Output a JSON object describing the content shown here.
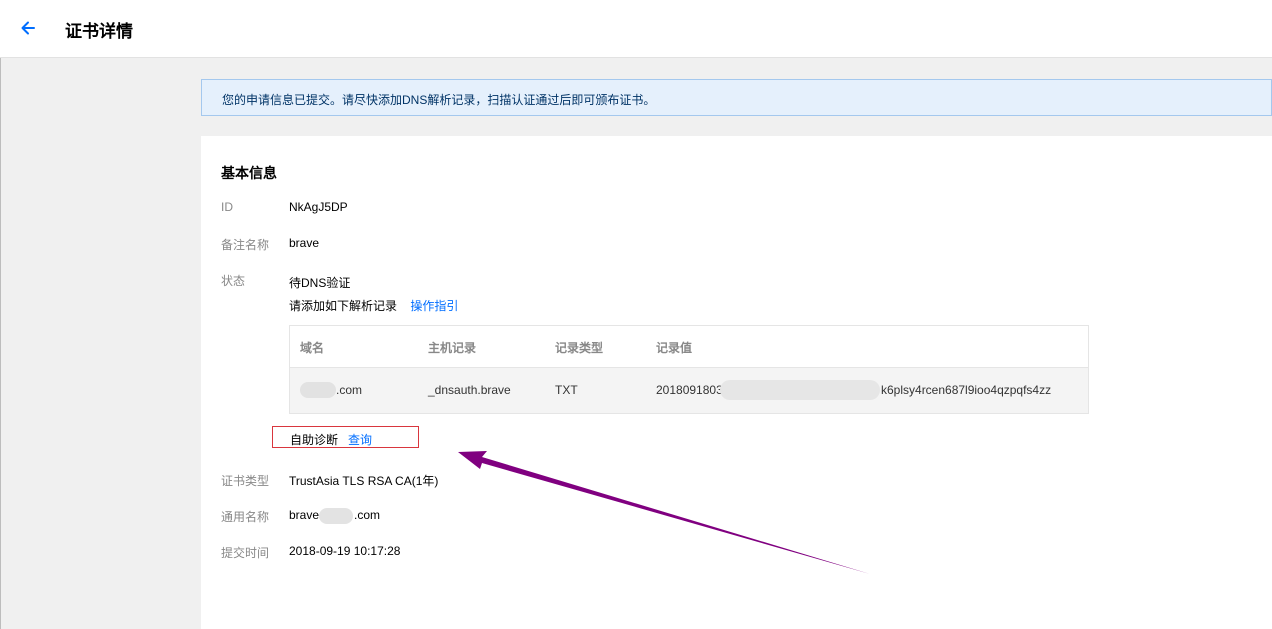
{
  "header": {
    "title": "证书详情",
    "back_icon": "arrow-left-icon"
  },
  "notice": {
    "text": "您的申请信息已提交。请尽快添加DNS解析记录，扫描认证通过后即可颁布证书。"
  },
  "basic_info": {
    "section_title": "基本信息",
    "id_label": "ID",
    "id_value": "NkAgJ5DP",
    "remark_label": "备注名称",
    "remark_value": "brave",
    "status_label": "状态",
    "status_value": "待DNS验证",
    "dns_prompt": "请添加如下解析记录",
    "guide_link": "操作指引",
    "dns_table": {
      "headers": [
        "域名",
        "主机记录",
        "记录类型",
        "记录值"
      ],
      "row": {
        "domain": ".com",
        "host": "_dnsauth.brave",
        "type": "TXT",
        "value_prefix": "2018091803",
        "value_suffix": "k6plsy4rcen687l9ioo4qzpqfs4zz"
      }
    },
    "self_diagnose_label": "自助诊断",
    "query_link": "查询",
    "cert_type_label": "证书类型",
    "cert_type_value": "TrustAsia TLS RSA CA(1年)",
    "common_name_label": "通用名称",
    "common_name_prefix": "brave",
    "common_name_suffix": ".com",
    "submit_time_label": "提交时间",
    "submit_time_value": "2018-09-19 10:17:28"
  },
  "colors": {
    "accent": "#006eff",
    "notice_bg": "#e5f0fc",
    "highlight_box": "#d9363e",
    "annotation_arrow": "#800080"
  }
}
